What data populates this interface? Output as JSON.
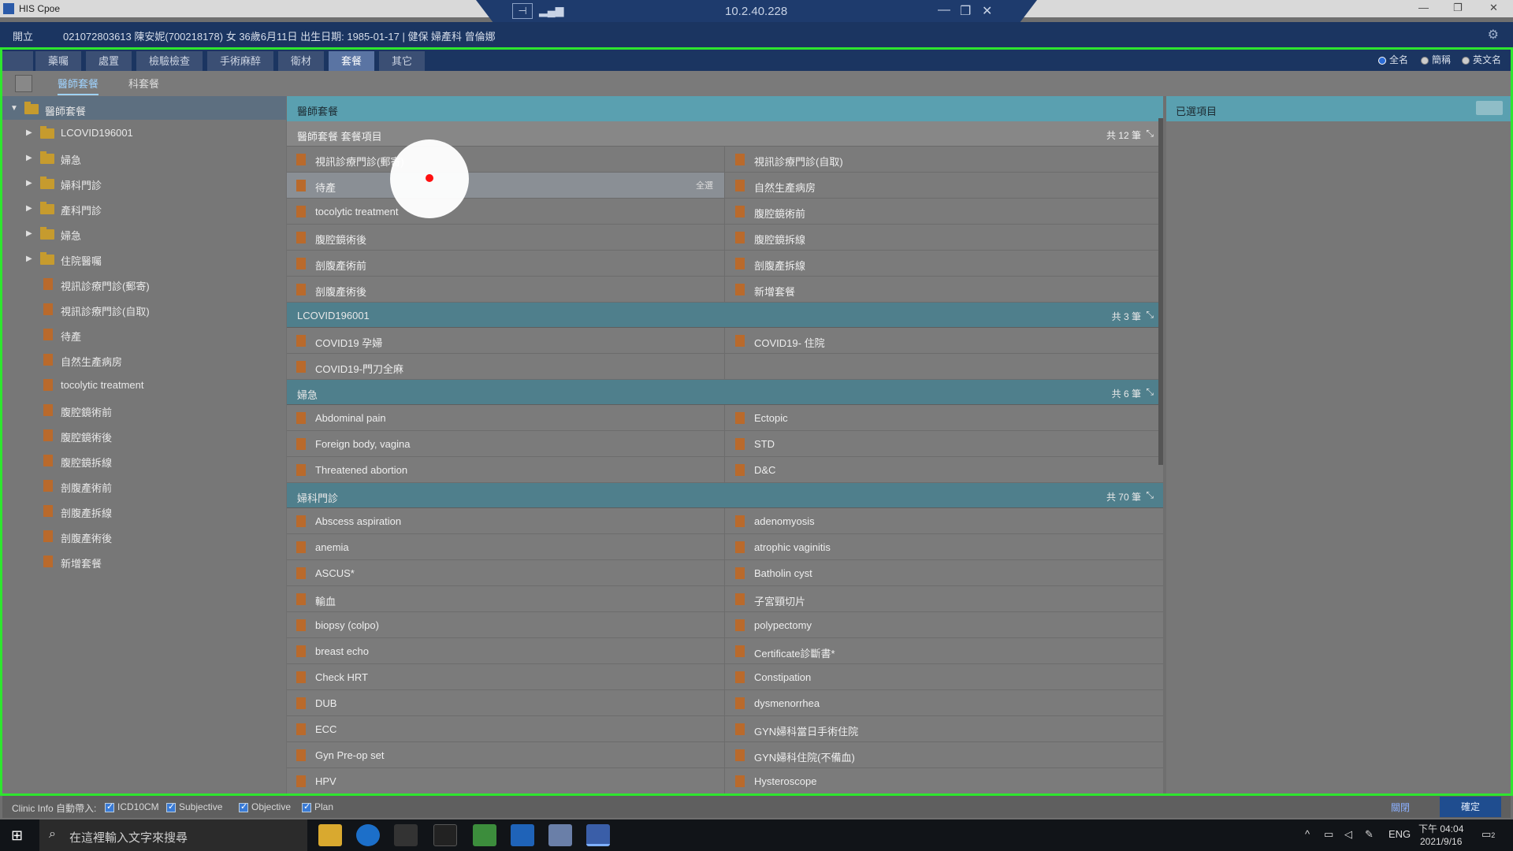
{
  "window": {
    "title": "HIS Cpoe",
    "host": "10.2.40.228"
  },
  "patient_bar": {
    "open_label": "開立",
    "info": "021072803613 陳安妮(700218178) 女 36歲6月11日 出生日期: 1985-01-17 | 健保 婦產科 曾倫娜"
  },
  "tabs": [
    "藥囑",
    "處置",
    "檢驗檢查",
    "手術麻醉",
    "衛材",
    "套餐",
    "其它"
  ],
  "active_tab": "套餐",
  "name_modes": [
    "全名",
    "簡稱",
    "英文名"
  ],
  "subtabs": [
    "醫師套餐",
    "科套餐"
  ],
  "tree": {
    "root": "醫師套餐",
    "folders": [
      "LCOVID196001",
      "婦急",
      "婦科門診",
      "產科門診",
      "婦急",
      "住院醫囑"
    ],
    "docs": [
      "視訊診療門診(郵寄)",
      "視訊診療門診(自取)",
      "待產",
      "自然生產病房",
      "tocolytic treatment",
      "腹腔鏡術前",
      "腹腔鏡術後",
      "腹腔鏡拆線",
      "剖腹產術前",
      "剖腹產拆線",
      "剖腹產術後",
      "新增套餐"
    ]
  },
  "main": {
    "title": "醫師套餐",
    "all_button": "全選",
    "sections": [
      {
        "name": "醫師套餐 套餐項目",
        "count": "共 12 筆",
        "style": "sub",
        "items": [
          "視訊診療門診(郵寄)",
          "視訊診療門診(自取)",
          "待產",
          "自然生產病房",
          "tocolytic treatment",
          "腹腔鏡術前",
          "腹腔鏡術後",
          "腹腔鏡拆線",
          "剖腹產術前",
          "剖腹產拆線",
          "剖腹產術後",
          "新增套餐"
        ]
      },
      {
        "name": "LCOVID196001",
        "count": "共 3 筆",
        "style": "teal",
        "items": [
          "COVID19 孕婦",
          "COVID19- 住院",
          "COVID19-門刀全麻",
          ""
        ]
      },
      {
        "name": "婦急",
        "count": "共 6 筆",
        "style": "teal",
        "items": [
          "Abdominal pain",
          "Ectopic",
          "Foreign body, vagina",
          "STD",
          "Threatened abortion",
          "D&C"
        ]
      },
      {
        "name": "婦科門診",
        "count": "共 70 筆",
        "style": "teal",
        "items": [
          "Abscess aspiration",
          "adenomyosis",
          "anemia",
          "atrophic vaginitis",
          "ASCUS*",
          "Batholin cyst",
          "輸血",
          "子宮頸切片",
          "biopsy (colpo)",
          "polypectomy",
          "breast echo",
          "Certificate診斷書*",
          "Check HRT",
          "Constipation",
          "DUB",
          "dysmenorrhea",
          "ECC",
          "GYN婦科當日手術住院",
          "Gyn Pre-op set",
          "GYN婦科住院(不備血)",
          "HPV",
          "Hysteroscope"
        ]
      }
    ]
  },
  "right_panel": {
    "title": "已選項目",
    "clear_label": ""
  },
  "footer": {
    "clinic_label": "Clinic Info 自動帶入:",
    "checks": [
      "ICD10CM",
      "Subjective",
      "Objective",
      "Plan"
    ],
    "close_label": "關閉",
    "confirm_label": "確定"
  },
  "taskbar": {
    "search_placeholder": "在這裡輸入文字來搜尋",
    "lang": "ENG",
    "time": "下午 04:04",
    "date": "2021/9/16",
    "notif": "2"
  }
}
